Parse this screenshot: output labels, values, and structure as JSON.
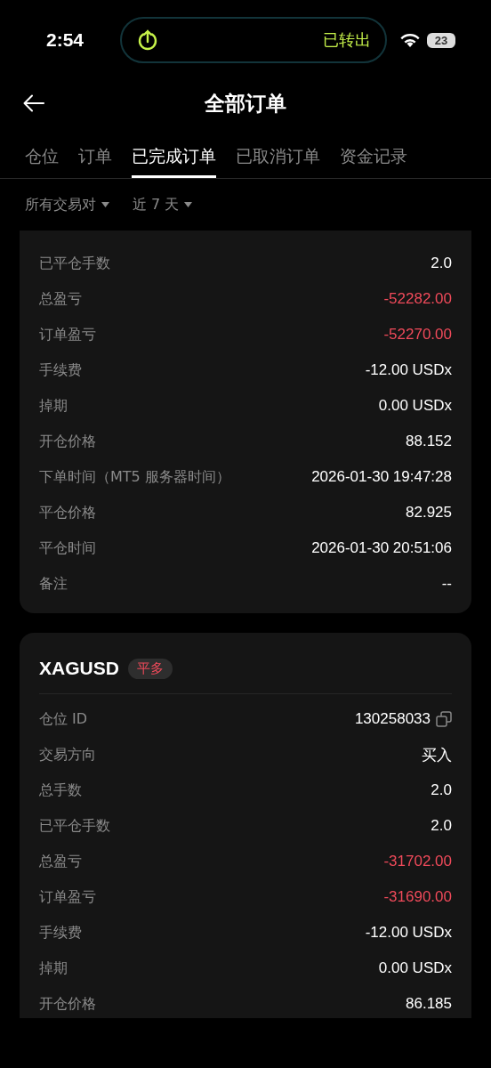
{
  "status_bar": {
    "time": "2:54",
    "activity": "已转出",
    "battery": "23"
  },
  "header": {
    "title": "全部订单"
  },
  "tabs": [
    {
      "label": "仓位",
      "selected": false
    },
    {
      "label": "订单",
      "selected": false
    },
    {
      "label": "已完成订单",
      "selected": true
    },
    {
      "label": "已取消订单",
      "selected": false
    },
    {
      "label": "资金记录",
      "selected": false
    }
  ],
  "filters": [
    {
      "label": "所有交易对"
    },
    {
      "label": "近 7 天"
    }
  ],
  "orders": [
    {
      "rows": [
        {
          "label": "已平仓手数",
          "value": "2.0",
          "loss": false,
          "copyable": false
        },
        {
          "label": "总盈亏",
          "value": "-52282.00",
          "loss": true,
          "copyable": false
        },
        {
          "label": "订单盈亏",
          "value": "-52270.00",
          "loss": true,
          "copyable": false
        },
        {
          "label": "手续费",
          "value": "-12.00 USDx",
          "loss": false,
          "copyable": false
        },
        {
          "label": "掉期",
          "value": "0.00 USDx",
          "loss": false,
          "copyable": false
        },
        {
          "label": "开仓价格",
          "value": "88.152",
          "loss": false,
          "copyable": false
        },
        {
          "label": "下单时间（MT5 服务器时间）",
          "value": "2026-01-30 19:47:28",
          "loss": false,
          "copyable": false
        },
        {
          "label": "平仓价格",
          "value": "82.925",
          "loss": false,
          "copyable": false
        },
        {
          "label": "平仓时间",
          "value": "2026-01-30 20:51:06",
          "loss": false,
          "copyable": false
        },
        {
          "label": "备注",
          "value": "--",
          "loss": false,
          "copyable": false
        }
      ]
    },
    {
      "symbol": "XAGUSD",
      "tag": "平多",
      "rows": [
        {
          "label": "仓位 ID",
          "value": "130258033",
          "loss": false,
          "copyable": true
        },
        {
          "label": "交易方向",
          "value": "买入",
          "loss": false,
          "copyable": false
        },
        {
          "label": "总手数",
          "value": "2.0",
          "loss": false,
          "copyable": false
        },
        {
          "label": "已平仓手数",
          "value": "2.0",
          "loss": false,
          "copyable": false
        },
        {
          "label": "总盈亏",
          "value": "-31702.00",
          "loss": true,
          "copyable": false
        },
        {
          "label": "订单盈亏",
          "value": "-31690.00",
          "loss": true,
          "copyable": false
        },
        {
          "label": "手续费",
          "value": "-12.00 USDx",
          "loss": false,
          "copyable": false
        },
        {
          "label": "掉期",
          "value": "0.00 USDx",
          "loss": false,
          "copyable": false
        },
        {
          "label": "开仓价格",
          "value": "86.185",
          "loss": false,
          "copyable": false
        }
      ]
    }
  ]
}
